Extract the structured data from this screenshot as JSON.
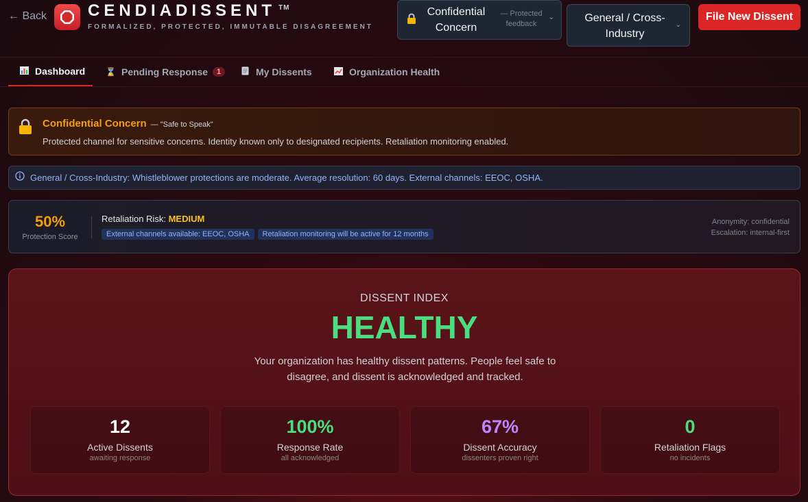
{
  "header": {
    "back_label": "← Back",
    "brand_title": "CENDIADISSENT",
    "brand_tm": "TM",
    "brand_subtitle": "FORMALIZED, PROTECTED, IMMUTABLE DISAGREEMENT",
    "logo_icon": "stop-octagon-icon",
    "confidentiality_select": {
      "value": "Confidential Concern",
      "hint": "— Protected feedback",
      "icon": "lock-icon"
    },
    "industry_select": {
      "value": "General / Cross-Industry"
    },
    "file_button_label": "File New Dissent",
    "accent_color": "#dc2626"
  },
  "tabs": [
    {
      "label": "Dashboard",
      "icon": "bar-chart-icon",
      "active": true
    },
    {
      "label": "Pending Response",
      "icon": "hourglass-icon",
      "badge": "1"
    },
    {
      "label": "My Dissents",
      "icon": "document-icon"
    },
    {
      "label": "Organization Health",
      "icon": "trend-chart-icon"
    }
  ],
  "confidential_banner": {
    "title": "Confidential Concern",
    "tag": "— \"Safe to Speak\"",
    "description": "Protected channel for sensitive concerns. Identity known only to designated recipients. Retaliation monitoring enabled.",
    "color": "#f59e0b"
  },
  "info_bar": {
    "text": "General / Cross-Industry: Whistleblower protections are moderate. Average resolution: 60 days. External channels: EEOC, OSHA."
  },
  "protection": {
    "score": "50%",
    "score_value": 0.5,
    "score_label": "Protection Score",
    "risk_label": "Retaliation Risk:",
    "risk_value": "MEDIUM",
    "chips": [
      "External channels available: EEOC, OSHA",
      "Retaliation monitoring will be active for 12 months"
    ],
    "anonymity": "Anonymity: confidential",
    "escalation": "Escalation: internal-first"
  },
  "dissent_index": {
    "kicker": "DISSENT INDEX",
    "status": "HEALTHY",
    "description": "Your organization has healthy dissent patterns. People feel safe to disagree, and dissent is acknowledged and tracked.",
    "stats": [
      {
        "value": "12",
        "label": "Active Dissents",
        "sub": "awaiting response",
        "color": "#ffffff"
      },
      {
        "value": "100%",
        "label": "Response Rate",
        "sub": "all acknowledged",
        "color": "#4ade80"
      },
      {
        "value": "67%",
        "label": "Dissent Accuracy",
        "sub": "dissenters proven right",
        "color": "#c084fc"
      },
      {
        "value": "0",
        "label": "Retaliation Flags",
        "sub": "no incidents",
        "color": "#4ade80"
      }
    ]
  }
}
